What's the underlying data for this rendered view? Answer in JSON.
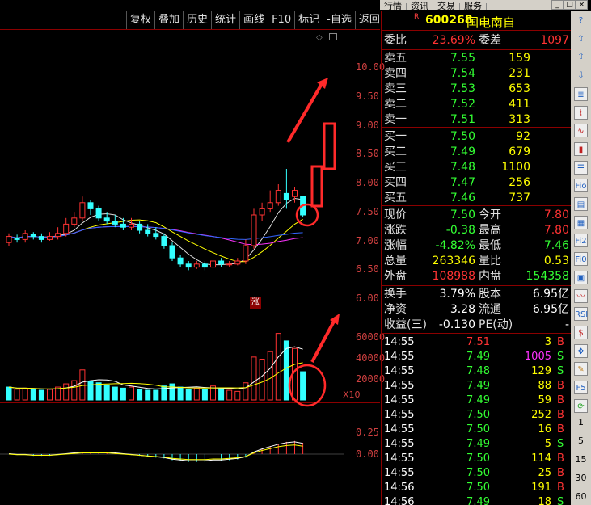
{
  "top_menu": [
    "行情",
    "资讯",
    "交易",
    "服务"
  ],
  "window_controls": [
    "_",
    "□",
    "×"
  ],
  "toolbar": [
    "复权",
    "叠加",
    "历史",
    "统计",
    "画线",
    "F10",
    "标记",
    "-自选",
    "返回"
  ],
  "price_axis": [
    "10.00",
    "9.50",
    "9.00",
    "8.50",
    "8.00",
    "7.50",
    "7.00",
    "6.50",
    "6.00"
  ],
  "volume_axis": [
    "60000",
    "40000",
    "20000"
  ],
  "volume_unit": "X10",
  "macd_axis": [
    "0.25",
    "0.00"
  ],
  "zhang_label": "涨",
  "stock": {
    "badge": "R",
    "code": "600268",
    "name": "国电南自"
  },
  "weibi": {
    "label": "委比",
    "value": "23.69%",
    "label2": "委差",
    "value2": "1097"
  },
  "asks": [
    {
      "label": "卖五",
      "price": "7.55",
      "vol": "159"
    },
    {
      "label": "卖四",
      "price": "7.54",
      "vol": "231"
    },
    {
      "label": "卖三",
      "price": "7.53",
      "vol": "653"
    },
    {
      "label": "卖二",
      "price": "7.52",
      "vol": "411"
    },
    {
      "label": "卖一",
      "price": "7.51",
      "vol": "313"
    }
  ],
  "bids": [
    {
      "label": "买一",
      "price": "7.50",
      "vol": "92"
    },
    {
      "label": "买二",
      "price": "7.49",
      "vol": "679"
    },
    {
      "label": "买三",
      "price": "7.48",
      "vol": "1100"
    },
    {
      "label": "买四",
      "price": "7.47",
      "vol": "256"
    },
    {
      "label": "买五",
      "price": "7.46",
      "vol": "737"
    }
  ],
  "stats": [
    {
      "l1": "现价",
      "v1": "7.50",
      "c1": "green",
      "l2": "今开",
      "v2": "7.80",
      "c2": "red"
    },
    {
      "l1": "涨跌",
      "v1": "-0.38",
      "c1": "green",
      "l2": "最高",
      "v2": "7.80",
      "c2": "red"
    },
    {
      "l1": "涨幅",
      "v1": "-4.82%",
      "c1": "green",
      "l2": "最低",
      "v2": "7.46",
      "c2": "green"
    },
    {
      "l1": "总量",
      "v1": "263346",
      "c1": "yellow",
      "l2": "量比",
      "v2": "0.53",
      "c2": "yellow"
    },
    {
      "l1": "外盘",
      "v1": "108988",
      "c1": "red",
      "l2": "内盘",
      "v2": "154358",
      "c2": "green"
    }
  ],
  "stats2": [
    {
      "l1": "换手",
      "v1": "3.79%",
      "l2": "股本",
      "v2": "6.95亿"
    },
    {
      "l1": "净资",
      "v1": "3.28",
      "l2": "流通",
      "v2": "6.95亿"
    },
    {
      "l1": "收益(三)",
      "v1": "-0.130",
      "l2": "PE(动)",
      "v2": "-"
    }
  ],
  "ticks": [
    {
      "time": "14:55",
      "price": "7.51",
      "pc": "red",
      "vol": "3",
      "vc": "yellow",
      "side": "B",
      "sc": "red"
    },
    {
      "time": "14:55",
      "price": "7.49",
      "pc": "green",
      "vol": "1005",
      "vc": "magenta",
      "side": "S",
      "sc": "green"
    },
    {
      "time": "14:55",
      "price": "7.48",
      "pc": "green",
      "vol": "129",
      "vc": "yellow",
      "side": "S",
      "sc": "green"
    },
    {
      "time": "14:55",
      "price": "7.49",
      "pc": "green",
      "vol": "88",
      "vc": "yellow",
      "side": "B",
      "sc": "red"
    },
    {
      "time": "14:55",
      "price": "7.49",
      "pc": "green",
      "vol": "59",
      "vc": "yellow",
      "side": "B",
      "sc": "red"
    },
    {
      "time": "14:55",
      "price": "7.50",
      "pc": "green",
      "vol": "252",
      "vc": "yellow",
      "side": "B",
      "sc": "red"
    },
    {
      "time": "14:55",
      "price": "7.50",
      "pc": "green",
      "vol": "16",
      "vc": "yellow",
      "side": "B",
      "sc": "red"
    },
    {
      "time": "14:55",
      "price": "7.49",
      "pc": "green",
      "vol": "5",
      "vc": "yellow",
      "side": "S",
      "sc": "green"
    },
    {
      "time": "14:55",
      "price": "7.50",
      "pc": "green",
      "vol": "114",
      "vc": "yellow",
      "side": "B",
      "sc": "red"
    },
    {
      "time": "14:55",
      "price": "7.50",
      "pc": "green",
      "vol": "25",
      "vc": "yellow",
      "side": "B",
      "sc": "red"
    },
    {
      "time": "14:56",
      "price": "7.50",
      "pc": "green",
      "vol": "191",
      "vc": "yellow",
      "side": "B",
      "sc": "red"
    },
    {
      "time": "14:56",
      "price": "7.49",
      "pc": "green",
      "vol": "18",
      "vc": "yellow",
      "side": "S",
      "sc": "green"
    }
  ],
  "right_tools": {
    "icons": [
      "help-icon",
      "up-arrow-icon",
      "up-outline-icon",
      "down-outline-icon",
      "list-icon",
      "chart-line-icon",
      "chart-line-icon-2",
      "candle-icon",
      "table-icon",
      "f10-icon",
      "document-icon",
      "calendar-icon",
      "f12-icon",
      "f0-icon",
      "grid-icon",
      "wave-icon",
      "rsi-icon",
      "dollar-icon",
      "move-icon",
      "pencil-icon",
      "f5-icon",
      "refresh-icon"
    ],
    "icon_glyphs": [
      "?",
      "⇧",
      "⇧",
      "⇩",
      "≣",
      "⌇",
      "∿",
      "▮",
      "☰",
      "Fio",
      "▤",
      "▦",
      "Fi2",
      "Fi0",
      "▣",
      "〰",
      "RSI",
      "$",
      "✥",
      "✎",
      "F5",
      "⟳"
    ],
    "periods": [
      "1",
      "5",
      "15",
      "30",
      "60"
    ]
  },
  "chart_data": {
    "type": "candlestick",
    "price_range": [
      6.0,
      10.0
    ],
    "candles": [
      [
        7.05,
        7.15,
        7.2,
        7.0
      ],
      [
        7.12,
        7.1,
        7.18,
        7.05
      ],
      [
        7.1,
        7.2,
        7.25,
        7.05
      ],
      [
        7.18,
        7.15,
        7.22,
        7.1
      ],
      [
        7.15,
        7.1,
        7.2,
        7.05
      ],
      [
        7.1,
        7.15,
        7.22,
        7.08
      ],
      [
        7.15,
        7.2,
        7.3,
        7.1
      ],
      [
        7.2,
        7.35,
        7.45,
        7.15
      ],
      [
        7.35,
        7.45,
        7.55,
        7.3
      ],
      [
        7.45,
        7.7,
        7.8,
        7.4
      ],
      [
        7.7,
        7.6,
        7.75,
        7.5
      ],
      [
        7.6,
        7.45,
        7.65,
        7.4
      ],
      [
        7.45,
        7.4,
        7.55,
        7.35
      ],
      [
        7.4,
        7.35,
        7.5,
        7.3
      ],
      [
        7.35,
        7.3,
        7.45,
        7.25
      ],
      [
        7.3,
        7.35,
        7.45,
        7.25
      ],
      [
        7.35,
        7.25,
        7.4,
        7.2
      ],
      [
        7.25,
        7.2,
        7.35,
        7.15
      ],
      [
        7.2,
        7.15,
        7.3,
        7.1
      ],
      [
        7.15,
        7.0,
        7.2,
        6.95
      ],
      [
        7.0,
        6.8,
        7.05,
        6.75
      ],
      [
        6.8,
        6.7,
        6.85,
        6.65
      ],
      [
        6.7,
        6.65,
        6.75,
        6.6
      ],
      [
        6.65,
        6.7,
        6.75,
        6.62
      ],
      [
        6.7,
        6.65,
        6.75,
        6.6
      ],
      [
        6.65,
        6.75,
        6.78,
        6.5
      ],
      [
        6.75,
        6.7,
        6.8,
        6.65
      ],
      [
        6.7,
        6.7,
        6.75,
        6.65
      ],
      [
        6.7,
        6.75,
        6.8,
        6.68
      ],
      [
        6.75,
        7.0,
        7.1,
        6.7
      ],
      [
        7.0,
        7.5,
        7.6,
        6.95
      ],
      [
        7.5,
        7.6,
        7.7,
        7.4
      ],
      [
        7.6,
        7.7,
        7.9,
        7.55
      ],
      [
        7.7,
        7.9,
        8.0,
        7.65
      ],
      [
        7.85,
        7.75,
        8.25,
        7.6
      ],
      [
        7.8,
        7.9,
        7.95,
        7.7
      ],
      [
        7.8,
        7.5,
        7.8,
        7.46
      ]
    ],
    "volume_range": [
      0,
      70000
    ],
    "volumes": [
      12000,
      10000,
      11000,
      10000,
      9000,
      10000,
      12000,
      15000,
      18000,
      28000,
      17000,
      16000,
      14000,
      12000,
      11000,
      12000,
      10000,
      9000,
      9000,
      13000,
      15000,
      12000,
      10000,
      11000,
      10000,
      13000,
      11000,
      9000,
      8000,
      16000,
      40000,
      38000,
      45000,
      62000,
      55000,
      48000,
      26300
    ],
    "volume_up": [
      false,
      true,
      true,
      false,
      false,
      true,
      true,
      true,
      true,
      true,
      false,
      false,
      false,
      false,
      false,
      true,
      false,
      false,
      false,
      false,
      false,
      false,
      false,
      true,
      false,
      true,
      false,
      true,
      true,
      true,
      true,
      true,
      true,
      true,
      false,
      true,
      false
    ],
    "macd_range": [
      -0.15,
      0.35
    ],
    "macd": [
      0.0,
      -0.01,
      -0.01,
      -0.02,
      -0.02,
      -0.02,
      -0.01,
      0.0,
      0.01,
      0.02,
      0.02,
      0.02,
      0.02,
      0.01,
      0.0,
      -0.01,
      -0.02,
      -0.03,
      -0.04,
      -0.05,
      -0.07,
      -0.08,
      -0.09,
      -0.09,
      -0.09,
      -0.08,
      -0.08,
      -0.07,
      -0.06,
      -0.04,
      0.02,
      0.06,
      0.09,
      0.12,
      0.14,
      0.15,
      0.13
    ]
  }
}
